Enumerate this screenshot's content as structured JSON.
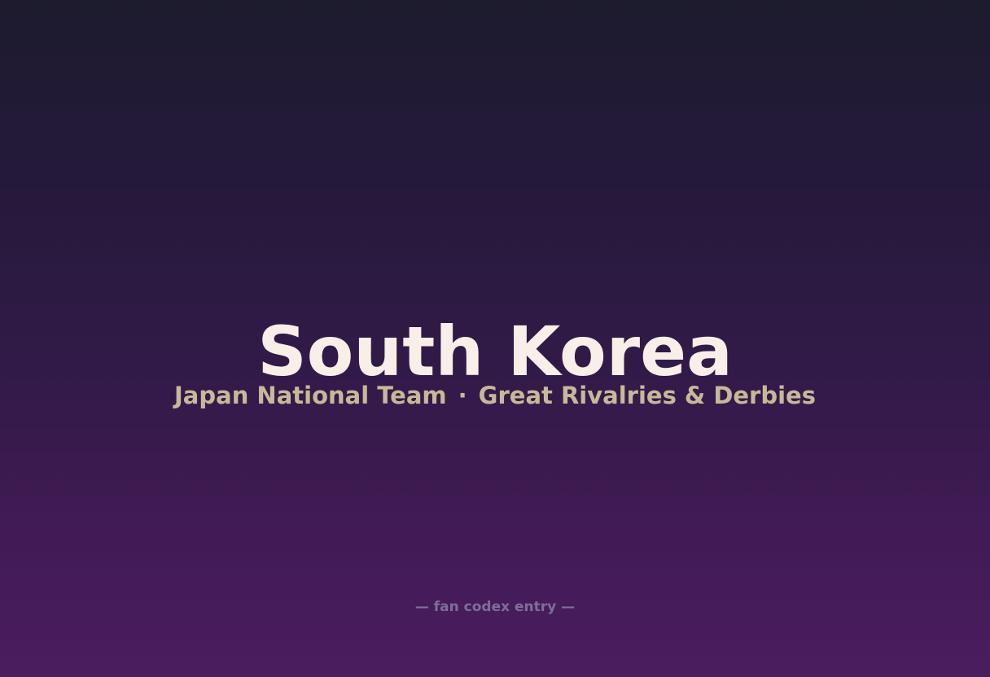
{
  "card": {
    "title": "South Korea",
    "subtitle_left": "Japan National Team",
    "subtitle_separator": "·",
    "subtitle_right": "Great Rivalries & Derbies",
    "footer": "— fan codex entry —"
  },
  "colors": {
    "background_top": "#1d1b2e",
    "background_bottom": "#4a1d5f",
    "title": "#f8efe8",
    "subtitle": "#c8b898",
    "footer": "#7d6f98"
  }
}
